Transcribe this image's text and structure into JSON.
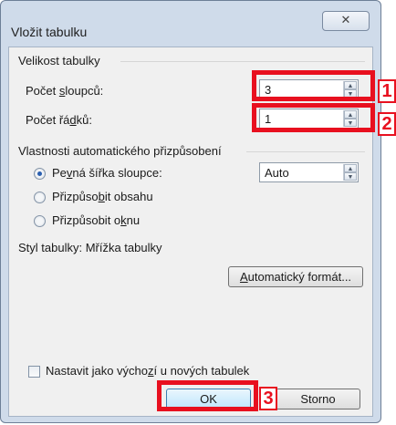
{
  "window": {
    "title": "Vložit tabulku",
    "close_glyph": "✕"
  },
  "table_size": {
    "group_label": "Velikost tabulky",
    "columns_label_pre": "Počet ",
    "columns_label_u": "s",
    "columns_label_post": "loupců:",
    "columns_value": "3",
    "rows_label_pre": "Počet řá",
    "rows_label_u": "d",
    "rows_label_post": "ků:",
    "rows_value": "1"
  },
  "autofit": {
    "group_label": "Vlastnosti automatického přizpůsobení",
    "fixed_pre": "Pe",
    "fixed_u": "v",
    "fixed_post": "ná šířka sloupce:",
    "fixed_value": "Auto",
    "contents_pre": "Přizpůso",
    "contents_u": "b",
    "contents_post": "it obsahu",
    "window_pre": "Přizpůsobit o",
    "window_u": "k",
    "window_post": "nu",
    "selected": "fixed"
  },
  "style": {
    "label": "Styl tabulky: Mřížka tabulky",
    "autoformat_u": "A",
    "autoformat_rest": "utomatický formát..."
  },
  "default_checkbox": {
    "label_pre": "Nastavit jako výcho",
    "label_u": "z",
    "label_post": "í u nových tabulek",
    "checked": false
  },
  "buttons": {
    "ok": "OK",
    "cancel": "Storno"
  },
  "annotations": {
    "color": "#e8101f",
    "labels": [
      "1",
      "2",
      "3"
    ]
  },
  "icons": {
    "spin_up": "▲",
    "spin_down": "▼"
  }
}
